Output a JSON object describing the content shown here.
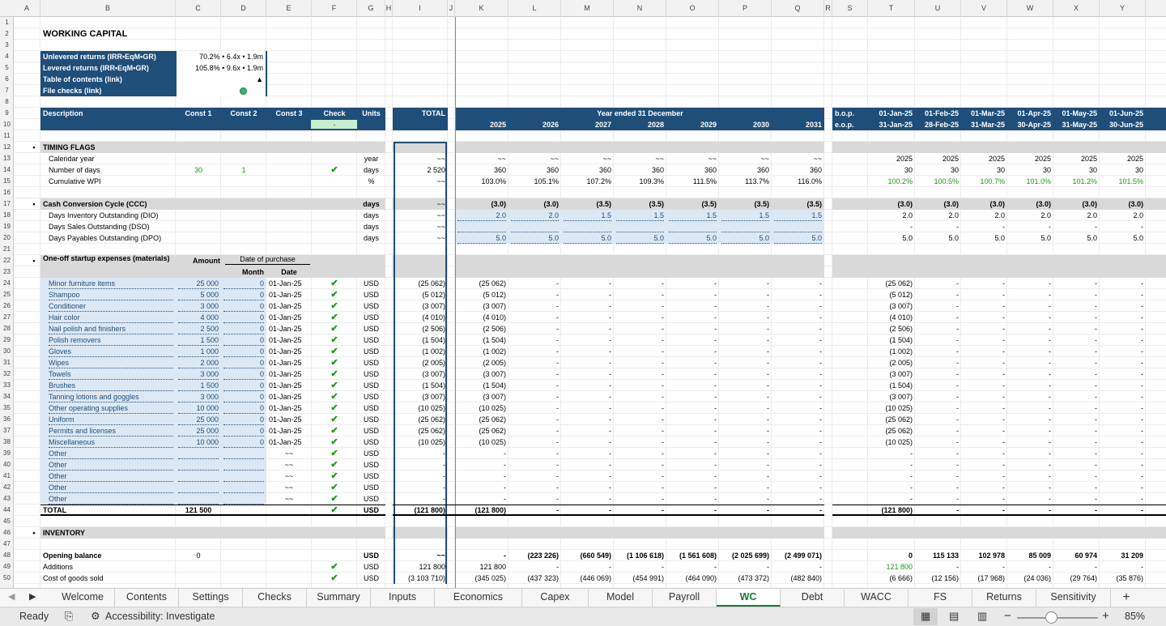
{
  "columns": [
    "A",
    "B",
    "C",
    "D",
    "E",
    "F",
    "G",
    "H",
    "I",
    "J",
    "K",
    "L",
    "M",
    "N",
    "O",
    "P",
    "Q",
    "R",
    "S",
    "T",
    "U",
    "V",
    "W",
    "X",
    "Y"
  ],
  "title": "WORKING CAPITAL",
  "summary": [
    {
      "label": "Unlevered returns (IRR•EqM•GR)",
      "value": "70.2% • 6.4x • 1.9m"
    },
    {
      "label": "Levered returns (IRR•EqM•GR)",
      "value": "105.8% • 9.6x • 1.9m"
    },
    {
      "label": "Table of contents (link)",
      "value": "▲"
    },
    {
      "label": "File checks (link)",
      "value": ""
    }
  ],
  "header": {
    "description": "Description",
    "const1": "Const 1",
    "const2": "Const 2",
    "const3": "Const 3",
    "check": "Check",
    "check_value": "-",
    "units": "Units",
    "total": "TOTAL",
    "year_ended": "Year ended 31 December",
    "bop": "b.o.p.",
    "eop": "e.o.p."
  },
  "years": [
    "2025",
    "2026",
    "2027",
    "2028",
    "2029",
    "2030",
    "2031"
  ],
  "months_bop": [
    "01-Jan-25",
    "01-Feb-25",
    "01-Mar-25",
    "01-Apr-25",
    "01-May-25",
    "01-Jun-25"
  ],
  "months_eop": [
    "31-Jan-25",
    "28-Feb-25",
    "31-Mar-25",
    "30-Apr-25",
    "31-May-25",
    "30-Jun-25"
  ],
  "timing": {
    "section": "TIMING FLAGS",
    "calendar_year": "Calendar year",
    "calendar_unit": "year",
    "tilde": "~~",
    "days_label": "Number of days",
    "days_c1": "30",
    "days_c2": "1",
    "days_unit": "days",
    "days_total": "2 520",
    "wpi_label": "Cumulative WPI",
    "wpi_unit": "%",
    "days_annual": [
      "360",
      "360",
      "360",
      "360",
      "360",
      "360",
      "360"
    ],
    "wpi_annual": [
      "103.0%",
      "105.1%",
      "107.2%",
      "109.3%",
      "111.5%",
      "113.7%",
      "116.0%"
    ],
    "year_monthly": [
      "2025",
      "2025",
      "2025",
      "2025",
      "2025",
      "2025"
    ],
    "days_monthly": [
      "30",
      "30",
      "30",
      "30",
      "30",
      "30"
    ],
    "wpi_monthly": [
      "100.2%",
      "100.5%",
      "100.7%",
      "101.0%",
      "101.2%",
      "101.5%"
    ]
  },
  "ccc": {
    "section": "Cash Conversion Cycle (CCC)",
    "unit": "days",
    "ccc_annual": [
      "(3.0)",
      "(3.0)",
      "(3.5)",
      "(3.5)",
      "(3.5)",
      "(3.5)",
      "(3.5)"
    ],
    "ccc_monthly": [
      "(3.0)",
      "(3.0)",
      "(3.0)",
      "(3.0)",
      "(3.0)",
      "(3.0)"
    ],
    "dio_label": "Days Inventory Outstanding (DIO)",
    "dio_annual": [
      "2.0",
      "2.0",
      "1.5",
      "1.5",
      "1.5",
      "1.5",
      "1.5"
    ],
    "dio_monthly": [
      "2.0",
      "2.0",
      "2.0",
      "2.0",
      "2.0",
      "2.0"
    ],
    "dso_label": "Days Sales Outstanding (DSO)",
    "dso_monthly": [
      "-",
      "-",
      "-",
      "-",
      "-",
      "-"
    ],
    "dpo_label": "Days Payables Outstanding (DPO)",
    "dpo_annual": [
      "5.0",
      "5.0",
      "5.0",
      "5.0",
      "5.0",
      "5.0",
      "5.0"
    ],
    "dpo_monthly": [
      "5.0",
      "5.0",
      "5.0",
      "5.0",
      "5.0",
      "5.0"
    ]
  },
  "startup": {
    "section": "One-off startup expenses (materials)",
    "amount": "Amount",
    "date_of_purchase": "Date of purchase",
    "month": "Month",
    "date": "Date",
    "dash": "-",
    "zero": "0",
    "unit": "USD",
    "items": [
      {
        "name": "Minor furniture items",
        "amount": "25 000",
        "date": "01-Jan-25",
        "total": "(25 062)"
      },
      {
        "name": "Shampoo",
        "amount": "5 000",
        "date": "01-Jan-25",
        "total": "(5 012)"
      },
      {
        "name": "Conditioner",
        "amount": "3 000",
        "date": "01-Jan-25",
        "total": "(3 007)"
      },
      {
        "name": "Hair color",
        "amount": "4 000",
        "date": "01-Jan-25",
        "total": "(4 010)"
      },
      {
        "name": "Nail polish and finishers",
        "amount": "2 500",
        "date": "01-Jan-25",
        "total": "(2 506)"
      },
      {
        "name": "Polish removers",
        "amount": "1 500",
        "date": "01-Jan-25",
        "total": "(1 504)"
      },
      {
        "name": "Gloves",
        "amount": "1 000",
        "date": "01-Jan-25",
        "total": "(1 002)"
      },
      {
        "name": "Wipes",
        "amount": "2 000",
        "date": "01-Jan-25",
        "total": "(2 005)"
      },
      {
        "name": "Towels",
        "amount": "3 000",
        "date": "01-Jan-25",
        "total": "(3 007)"
      },
      {
        "name": "Brushes",
        "amount": "1 500",
        "date": "01-Jan-25",
        "total": "(1 504)"
      },
      {
        "name": "Tanning lotions and goggles",
        "amount": "3 000",
        "date": "01-Jan-25",
        "total": "(3 007)"
      },
      {
        "name": "Other operating supplies",
        "amount": "10 000",
        "date": "01-Jan-25",
        "total": "(10 025)"
      },
      {
        "name": "Uniform",
        "amount": "25 000",
        "date": "01-Jan-25",
        "total": "(25 062)"
      },
      {
        "name": "Permits and licenses",
        "amount": "25 000",
        "date": "01-Jan-25",
        "total": "(25 062)"
      },
      {
        "name": "Miscellaneous",
        "amount": "10 000",
        "date": "01-Jan-25",
        "total": "(10 025)"
      },
      {
        "name": "Other",
        "amount": "",
        "date": "~~",
        "total": "-"
      },
      {
        "name": "Other",
        "amount": "",
        "date": "~~",
        "total": "-"
      },
      {
        "name": "Other",
        "amount": "",
        "date": "~~",
        "total": "-"
      },
      {
        "name": "Other",
        "amount": "",
        "date": "~~",
        "total": "-"
      },
      {
        "name": "Other",
        "amount": "",
        "date": "~~",
        "total": "-"
      }
    ],
    "total_label": "TOTAL",
    "total_amount": "121 500",
    "total_value": "(121 800)"
  },
  "inventory": {
    "section": "INVENTORY",
    "opening_label": "Opening balance",
    "opening_c1": "0",
    "opening_annual": [
      "-",
      "(223 226)",
      "(660 549)",
      "(1 106 618)",
      "(1 561 608)",
      "(2 025 699)",
      "(2 499 071)"
    ],
    "opening_monthly": [
      "0",
      "115 133",
      "102 978",
      "85 009",
      "60 974",
      "31 209"
    ],
    "additions_label": "Additions",
    "additions_total": "121 800",
    "additions_2025": "121 800",
    "additions_monthly0": "121 800",
    "cogs_label": "Cost of goods sold",
    "cogs_total": "(3 103 710)",
    "cogs_annual": [
      "(345 025)",
      "(437 323)",
      "(446 069)",
      "(454 991)",
      "(464 090)",
      "(473 372)",
      "(482 840)"
    ],
    "cogs_monthly": [
      "(6 666)",
      "(12 156)",
      "(17 968)",
      "(24 036)",
      "(29 764)",
      "(35 876)"
    ]
  },
  "tabs": [
    "Welcome",
    "Contents",
    "Settings",
    "Checks",
    "Summary",
    "Inputs",
    "Economics",
    "Capex",
    "Model",
    "Payroll",
    "WC",
    "Debt",
    "WACC",
    "FS",
    "Returns",
    "Sensitivity"
  ],
  "active_tab": "WC",
  "status": {
    "ready": "Ready",
    "accessibility": "Accessibility: Investigate",
    "zoom": "85%"
  }
}
